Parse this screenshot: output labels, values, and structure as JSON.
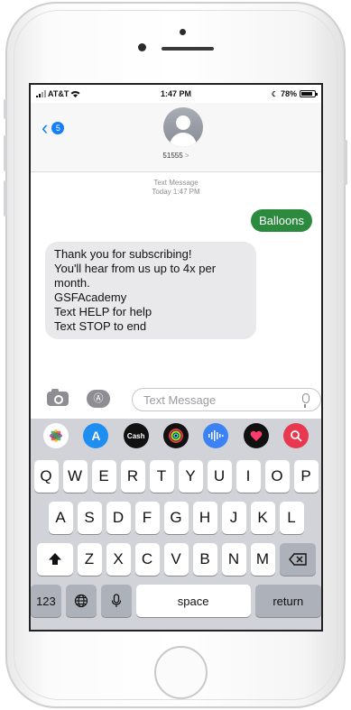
{
  "status_bar": {
    "carrier": "AT&T",
    "time": "1:47 PM",
    "battery": "78%"
  },
  "header": {
    "back_badge": "5",
    "contact_name": "51555",
    "contact_chevron": ">"
  },
  "timestamp": {
    "line1": "Text Message",
    "line2": "Today 1:47 PM"
  },
  "messages": {
    "sent": "Balloons",
    "received_lines": [
      "Thank you for subscribing!",
      "You'll hear from us up to 4x per",
      "month.",
      "GSFAcademy",
      "Text HELP for help",
      "Text STOP to end"
    ]
  },
  "compose": {
    "placeholder": "Text Message"
  },
  "app_drawer": [
    {
      "name": "photos-app-icon",
      "label": "",
      "color": "#ffffff"
    },
    {
      "name": "app-store-icon",
      "label": "A",
      "color": "#1f8ef1"
    },
    {
      "name": "apple-cash-icon",
      "label": "Cash",
      "color": "#111111"
    },
    {
      "name": "activity-icon",
      "label": "",
      "color": "#111111"
    },
    {
      "name": "audio-message-icon",
      "label": "",
      "color": "#3b82f6"
    },
    {
      "name": "digital-touch-icon",
      "label": "",
      "color": "#111111"
    },
    {
      "name": "web-search-icon",
      "label": "",
      "color": "#e8384f"
    }
  ],
  "keyboard": {
    "row1": [
      "Q",
      "W",
      "E",
      "R",
      "T",
      "Y",
      "U",
      "I",
      "O",
      "P"
    ],
    "row2": [
      "A",
      "S",
      "D",
      "F",
      "G",
      "H",
      "J",
      "K",
      "L"
    ],
    "row3": [
      "Z",
      "X",
      "C",
      "V",
      "B",
      "N",
      "M"
    ],
    "numbers_label": "123",
    "space_label": "space",
    "return_label": "return"
  }
}
